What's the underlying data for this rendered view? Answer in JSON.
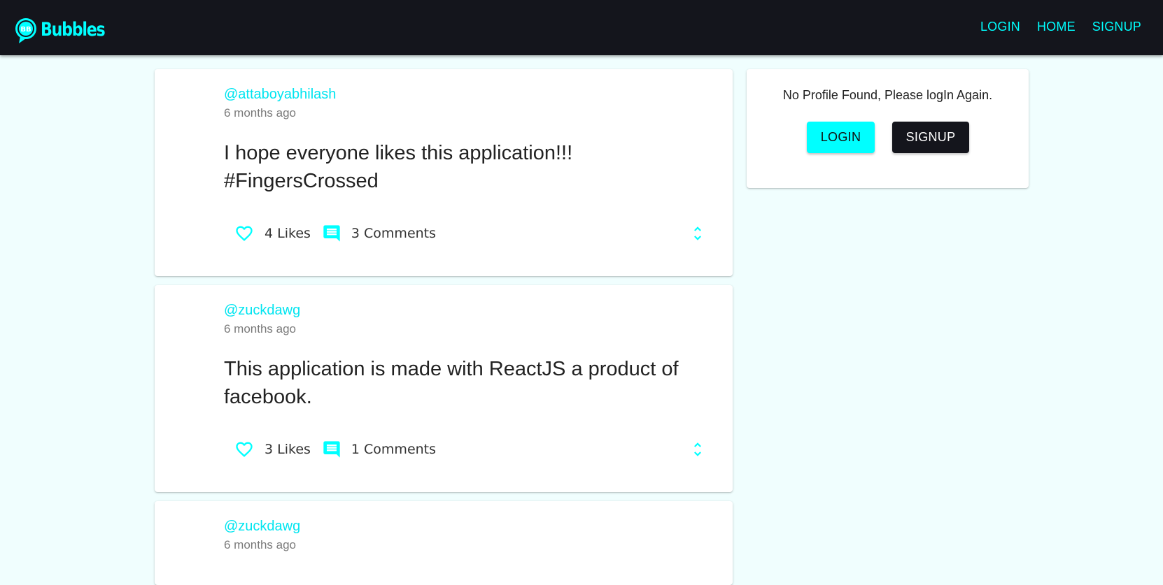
{
  "navbar": {
    "brand": "Bubbles",
    "logo_initials": "BB",
    "links": [
      {
        "label": "LOGIN"
      },
      {
        "label": "HOME"
      },
      {
        "label": "SIGNUP"
      }
    ]
  },
  "posts": [
    {
      "username": "@attaboyabhilash",
      "time": "6 months ago",
      "body": "I hope everyone likes this application!!! #FingersCrossed",
      "likes": "4 Likes",
      "comments": "3 Comments"
    },
    {
      "username": "@zuckdawg",
      "time": "6 months ago",
      "body": "This application is made with ReactJS a product of facebook.",
      "likes": "3 Likes",
      "comments": "1 Comments"
    },
    {
      "username": "@zuckdawg",
      "time": "6 months ago"
    }
  ],
  "profile": {
    "message": "No Profile Found, Please logIn Again.",
    "login_label": "LOGIN",
    "signup_label": "SIGNUP"
  },
  "colors": {
    "accent": "#00ffff",
    "navbar": "#14151c",
    "page_bg": "#f0fefe"
  },
  "icons": [
    "bubble-logo-icon",
    "heart-outline-icon",
    "comment-icon",
    "unfold-more-icon"
  ]
}
